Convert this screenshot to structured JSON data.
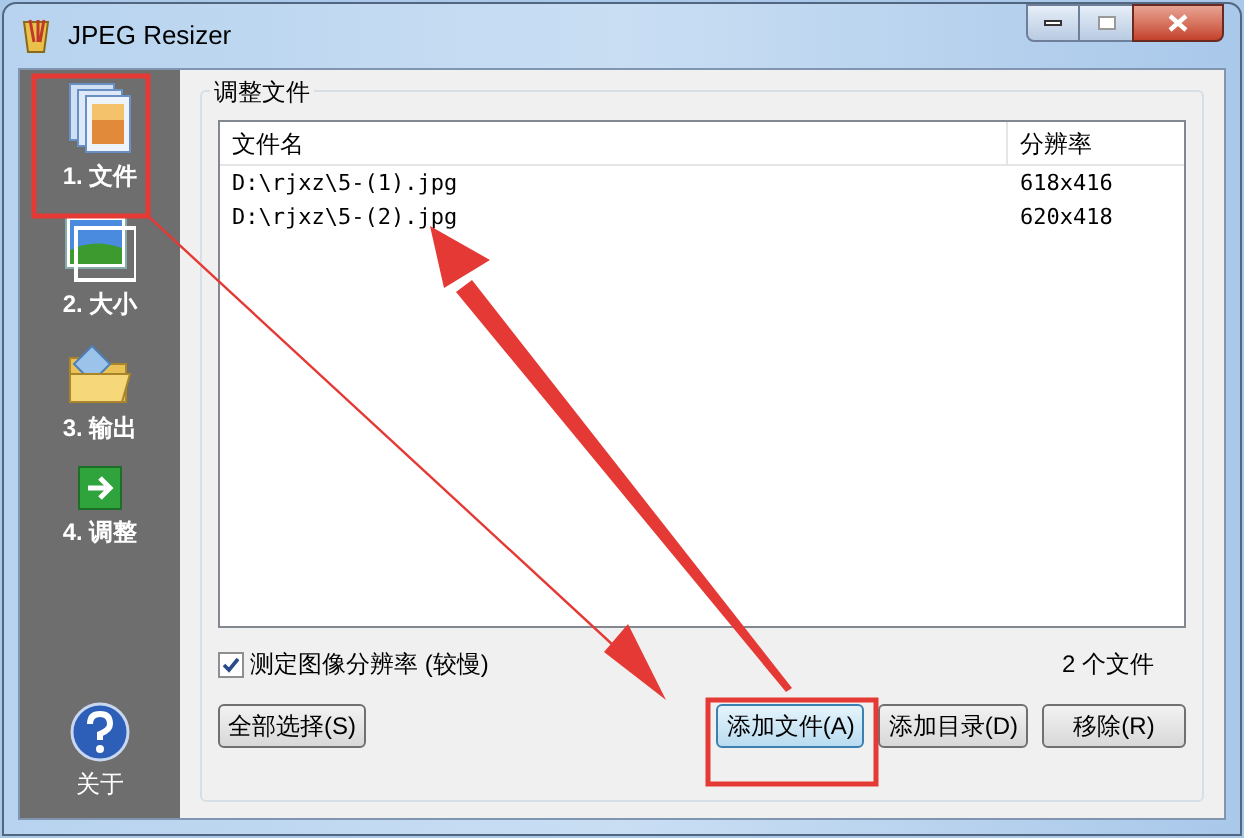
{
  "window": {
    "title": "JPEG Resizer"
  },
  "sidebar": {
    "items": [
      {
        "label": "1. 文件",
        "kind": "files"
      },
      {
        "label": "2. 大小",
        "kind": "size"
      },
      {
        "label": "3. 输出",
        "kind": "output"
      },
      {
        "label": "4. 调整",
        "kind": "resize"
      }
    ],
    "about": {
      "label": "关于"
    }
  },
  "group": {
    "title": "调整文件"
  },
  "table": {
    "columns": [
      "文件名",
      "分辨率"
    ],
    "rows": [
      [
        "D:\\rjxz\\5-(1).jpg",
        "618x416"
      ],
      [
        "D:\\rjxz\\5-(2).jpg",
        "620x418"
      ]
    ]
  },
  "measure_checkbox": {
    "label": "测定图像分辨率 (较慢)",
    "checked": true
  },
  "file_count": "2 个文件",
  "buttons": [
    {
      "label": "全部选择(S)",
      "focused": false
    },
    {
      "label": "添加文件(A)",
      "focused": true
    },
    {
      "label": "添加目录(D)",
      "focused": false
    },
    {
      "label": "移除(R)",
      "focused": false
    }
  ]
}
